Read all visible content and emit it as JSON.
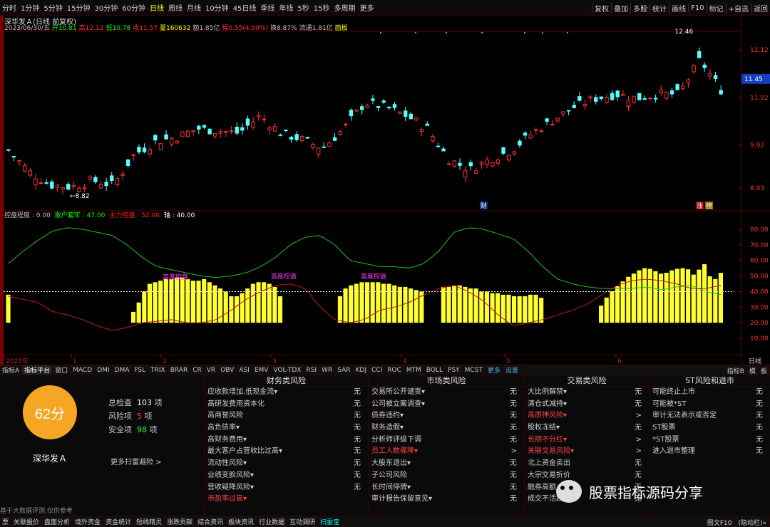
{
  "toolbar": {
    "periods": [
      "分时",
      "1分钟",
      "5分钟",
      "15分钟",
      "30分钟",
      "60分钟",
      "日线",
      "周线",
      "月线",
      "10分钟",
      "45日线",
      "季线",
      "年线",
      "5秒",
      "15秒",
      "多周期",
      "更多"
    ],
    "active_period": "日线",
    "right": [
      "复权",
      "叠加",
      "多股",
      "统计",
      "画线",
      "F10",
      "标记",
      "+自选",
      "返回"
    ]
  },
  "stock": {
    "title": "深华发Ａ(日线 前复权)",
    "ohlc": [
      {
        "t": "2023/06/30/五",
        "c": "#c0c0c0"
      },
      {
        "t": "开10.81",
        "c": "#00ff00"
      },
      {
        "t": "高12.12",
        "c": "#ff3030"
      },
      {
        "t": "低10.78",
        "c": "#00ff00"
      },
      {
        "t": "收11.57",
        "c": "#ff3030"
      },
      {
        "t": "量160632",
        "c": "#ffff00"
      },
      {
        "t": "额1.85亿",
        "c": "#c0c0c0"
      },
      {
        "t": "幅0.55(4.99%)",
        "c": "#ff3030"
      },
      {
        "t": "换8.87%",
        "c": "#c0c0c0"
      },
      {
        "t": "流通1.81亿",
        "c": "#c0c0c0"
      },
      {
        "t": "面板",
        "c": "#ffff00"
      }
    ]
  },
  "price_axis": {
    "labels": [
      "12.12",
      "11.02",
      "9.92",
      "8.93"
    ],
    "current": "11.45"
  },
  "annotations": {
    "high": "12.46",
    "low": "8.82",
    "cai": "财",
    "zhang": "涨",
    "pan": "榜"
  },
  "indicator": {
    "legend": [
      {
        "t": "控盘程度 : 0.00",
        "c": "#c0c0c0"
      },
      {
        "t": "散户套牢 : 47.00",
        "c": "#00ff00"
      },
      {
        "t": "主力控盘 : 52.00",
        "c": "#ff2020"
      },
      {
        "t": "轴 : 40.00",
        "c": "#ffffff"
      }
    ],
    "axis_labels": [
      "80.00",
      "70.00",
      "60.00",
      "50.00",
      "40.00",
      "30.00",
      "20.00",
      "10.00"
    ],
    "labels": [
      "高度控盘",
      "高度控盘",
      "高度控盘"
    ]
  },
  "time_axis": {
    "labels": [
      "2022年",
      "1",
      "2",
      "3",
      "4",
      "5",
      "6"
    ],
    "right": "日线"
  },
  "indicator_tabs": {
    "items": [
      "指标A",
      "指标平台",
      "窗口",
      "MACD",
      "DMI",
      "DMA",
      "FSL",
      "TRIX",
      "BRAR",
      "CR",
      "VR",
      "OBV",
      "ASI",
      "EMV",
      "VOL-TDX",
      "RSI",
      "WR",
      "SAR",
      "KDJ",
      "CCI",
      "ROC",
      "MTM",
      "BOLL",
      "PSY",
      "MCST",
      "更多",
      "设置"
    ],
    "active": "指标平台",
    "right": [
      "指标B",
      "模",
      "板"
    ]
  },
  "risk": {
    "score": "62分",
    "stock_name": "深华发Ａ",
    "total_label": "总检查",
    "total": "103",
    "total_unit": "项",
    "risk_label": "风险项",
    "risk_count": "5",
    "risk_unit": "项",
    "safe_label": "安全项",
    "safe_count": "98",
    "safe_unit": "项",
    "more": "更多扫雷避险 >",
    "disclaimer": "基于大数据评测,仅供参考",
    "columns": [
      {
        "title": "财务类风险",
        "rows": [
          {
            "n": "应收款增加,低现金流▾",
            "v": "无"
          },
          {
            "n": "高研发费用资本化",
            "v": "无"
          },
          {
            "n": "高商誉风险",
            "v": "无"
          },
          {
            "n": "高负债率▾",
            "v": "无"
          },
          {
            "n": "高财务费用▾",
            "v": "无"
          },
          {
            "n": "最大客户占营收比过高▾",
            "v": "无"
          },
          {
            "n": "流动性风险▾",
            "v": "无"
          },
          {
            "n": "业绩变脸风险▾",
            "v": "无"
          },
          {
            "n": "营收疑降风险▾",
            "v": "无"
          },
          {
            "n": "市盈率过高▾",
            "v": "",
            "red": true
          }
        ]
      },
      {
        "title": "市场类风险",
        "rows": [
          {
            "n": "交易所公开谴责▾",
            "v": "无"
          },
          {
            "n": "公司被立案调查▾",
            "v": "无"
          },
          {
            "n": "债券违约▾",
            "v": "无"
          },
          {
            "n": "财务造假▾",
            "v": "无"
          },
          {
            "n": "分析师评级下调",
            "v": "无"
          },
          {
            "n": "员工人数骤降▾",
            "v": ">",
            "red": true
          },
          {
            "n": "大股东退出▾",
            "v": "无"
          },
          {
            "n": "子公司风险",
            "v": "无"
          },
          {
            "n": "长时间停牌▾",
            "v": "无"
          },
          {
            "n": "审计报告保留意见▾",
            "v": "无"
          }
        ]
      },
      {
        "title": "交易类风险",
        "rows": [
          {
            "n": "大比例解禁▾",
            "v": "无"
          },
          {
            "n": "清仓式减持▾",
            "v": "无"
          },
          {
            "n": "高质押风险▾",
            "v": ">",
            "red": true
          },
          {
            "n": "股权冻结▾",
            "v": "无"
          },
          {
            "n": "长期不分红▾",
            "v": ">",
            "red": true
          },
          {
            "n": "关联交易风险▾",
            "v": ">",
            "red": true
          },
          {
            "n": "北上资金卖出",
            "v": "无"
          },
          {
            "n": "大宗交易折价",
            "v": "无"
          },
          {
            "n": "融券高额",
            "v": "无"
          },
          {
            "n": "成交不活跃▾",
            "v": "无"
          }
        ]
      },
      {
        "title": "ST风险和退市",
        "rows": [
          {
            "n": "可能终止上市",
            "v": "无"
          },
          {
            "n": "可能被*ST",
            "v": "无"
          },
          {
            "n": "审计无法表示或否定",
            "v": "无"
          },
          {
            "n": "ST股票",
            "v": "无"
          },
          {
            "n": "*ST股票",
            "v": "无"
          },
          {
            "n": "进入退市整理",
            "v": "无"
          }
        ]
      }
    ]
  },
  "bottom_tabs": {
    "items": [
      "票",
      "关联报价",
      "盘面分析",
      "境外资金",
      "资金统计",
      "短线精灵",
      "涨跌贡献",
      "综合资讯",
      "板块资讯",
      "行业数据",
      "互动调研",
      "扫雷宝"
    ],
    "highlight": "扫雷宝",
    "right": [
      "图文F10",
      "(隐动栏)»"
    ]
  },
  "watermark": "股票指标源码分享",
  "colors": {
    "up": "#ff3030",
    "down": "#54ffff",
    "vol_bar": "#ffff30",
    "green_line": "#1cc21c",
    "red_line": "#c01a1a",
    "score_bg": "#f5a623"
  }
}
